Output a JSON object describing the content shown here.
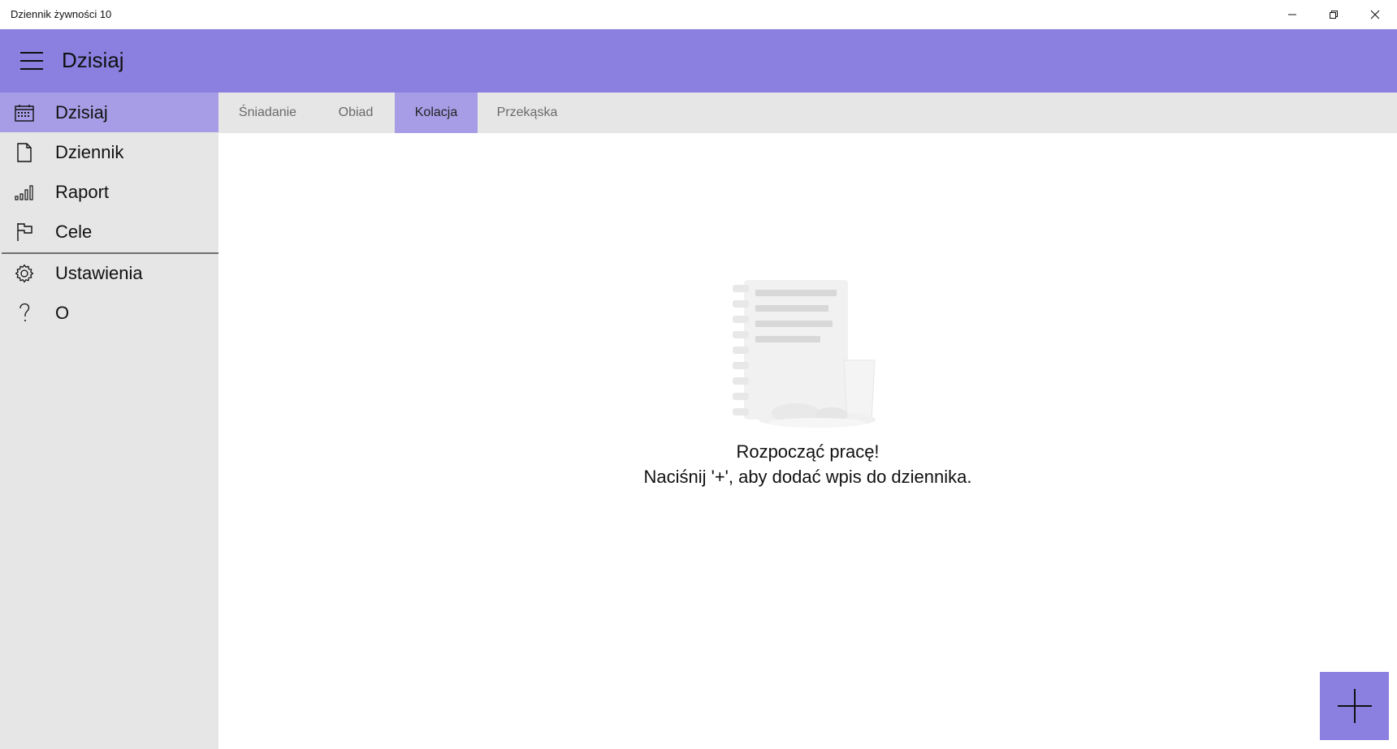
{
  "window": {
    "title": "Dziennik żywności 10",
    "controls": [
      "minimize-icon",
      "restore-icon",
      "close-icon"
    ]
  },
  "header": {
    "title": "Dzisiaj",
    "menu_icon": "hamburger-icon"
  },
  "sidebar": {
    "items": [
      {
        "label": "Dzisiaj",
        "icon": "calendar-icon",
        "active": true
      },
      {
        "label": "Dziennik",
        "icon": "document-icon",
        "active": false
      },
      {
        "label": "Raport",
        "icon": "bar-chart-icon",
        "active": false
      },
      {
        "label": "Cele",
        "icon": "flag-icon",
        "active": false
      },
      {
        "label": "Ustawienia",
        "icon": "gear-icon",
        "active": false
      },
      {
        "label": "O",
        "icon": "question-icon",
        "active": false
      }
    ]
  },
  "tabs": {
    "items": [
      {
        "label": "Śniadanie",
        "active": false
      },
      {
        "label": "Obiad",
        "active": false
      },
      {
        "label": "Kolacja",
        "active": true
      },
      {
        "label": "Przekąska",
        "active": false
      }
    ]
  },
  "empty_state": {
    "title": "Rozpocząć pracę!",
    "hint": "Naciśnij '+', aby dodać wpis do dziennika.",
    "illustration": "notebook-illustration"
  },
  "fab": {
    "icon": "plus-icon"
  },
  "colors": {
    "accent": "#8b80e0",
    "accent_light": "#a79de6",
    "sidebar_bg": "#e6e6e6"
  }
}
